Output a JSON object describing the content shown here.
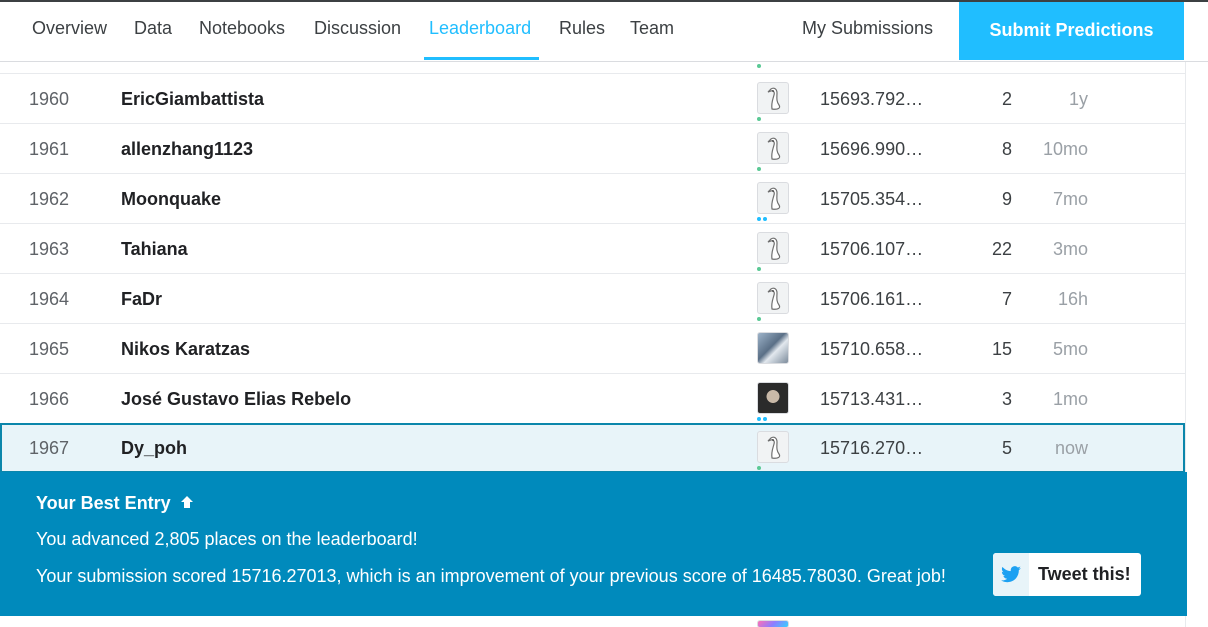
{
  "nav": {
    "tabs": [
      {
        "label": "Overview"
      },
      {
        "label": "Data"
      },
      {
        "label": "Notebooks"
      },
      {
        "label": "Discussion"
      },
      {
        "label": "Leaderboard",
        "active": true
      },
      {
        "label": "Rules"
      },
      {
        "label": "Team"
      }
    ],
    "my_submissions": "My Submissions",
    "submit_button": "Submit Predictions"
  },
  "leaderboard": {
    "rows": [
      {
        "rank": "1960",
        "team": "EricGiambattista",
        "score": "15693.792…",
        "entries": "2",
        "last": "1y",
        "avatar": "default-goose-icon"
      },
      {
        "rank": "1961",
        "team": "allenzhang1123",
        "score": "15696.990…",
        "entries": "8",
        "last": "10mo",
        "avatar": "default-goose-icon"
      },
      {
        "rank": "1962",
        "team": "Moonquake",
        "score": "15705.354…",
        "entries": "9",
        "last": "7mo",
        "avatar": "default-goose-icon"
      },
      {
        "rank": "1963",
        "team": "Tahiana",
        "score": "15706.107…",
        "entries": "22",
        "last": "3mo",
        "avatar": "default-goose-icon"
      },
      {
        "rank": "1964",
        "team": "FaDr",
        "score": "15706.161…",
        "entries": "7",
        "last": "16h",
        "avatar": "default-goose-icon"
      },
      {
        "rank": "1965",
        "team": "Nikos Karatzas",
        "score": "15710.658…",
        "entries": "15",
        "last": "5mo",
        "avatar": "user-photo"
      },
      {
        "rank": "1966",
        "team": "José Gustavo Elias Rebelo",
        "score": "15713.431…",
        "entries": "3",
        "last": "1mo",
        "avatar": "user-photo"
      },
      {
        "rank": "1967",
        "team": "Dy_poh",
        "score": "15716.270…",
        "entries": "5",
        "last": "now",
        "avatar": "default-goose-icon",
        "highlight": true
      }
    ]
  },
  "best_entry": {
    "title": "Your Best Entry",
    "title_icon": "arrow-up-icon",
    "advanced_text": "You advanced 2,805 places on the leaderboard!",
    "score_text": "Your submission scored 15716.27013, which is an improvement of your previous score of 16485.78030. Great job!",
    "tweet_label": "Tweet this!",
    "tweet_icon": "twitter-bird-icon"
  },
  "colors": {
    "accent": "#20beff",
    "banner": "#008abc",
    "highlight_row": "#e8f4f9",
    "tier_novice": "#5ac995",
    "tier_contributor": "#20beff"
  }
}
